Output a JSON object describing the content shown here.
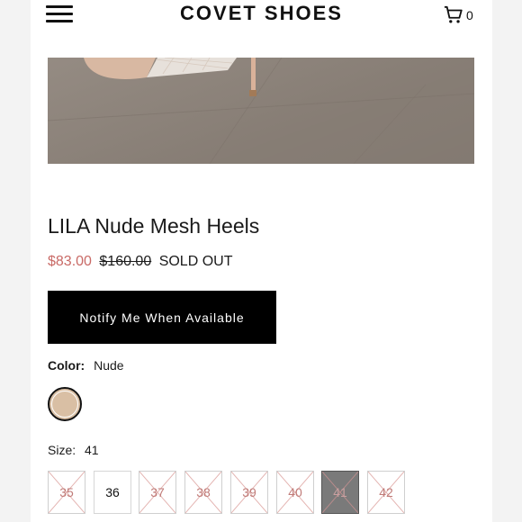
{
  "header": {
    "brand": "COVET SHOES",
    "cart_count": "0",
    "menu_icon": "hamburger-menu-icon",
    "cart_icon": "shopping-cart-icon"
  },
  "product": {
    "title": "LILA Nude Mesh Heels",
    "sale_price": "$83.00",
    "original_price": "$160.00",
    "stock_status": "SOLD OUT",
    "notify_button": "Notify Me When Available",
    "color_label": "Color:",
    "color_value": "Nude",
    "size_label": "Size:",
    "size_value": "41"
  },
  "sizes": [
    {
      "label": "35",
      "available": false,
      "selected": false
    },
    {
      "label": "36",
      "available": true,
      "selected": false
    },
    {
      "label": "37",
      "available": false,
      "selected": false
    },
    {
      "label": "38",
      "available": false,
      "selected": false
    },
    {
      "label": "39",
      "available": false,
      "selected": false
    },
    {
      "label": "40",
      "available": false,
      "selected": false
    },
    {
      "label": "41",
      "available": false,
      "selected": true
    },
    {
      "label": "42",
      "available": false,
      "selected": false
    }
  ],
  "colors": {
    "sale_price": "#c96a66",
    "button_bg": "#000000",
    "swatch_nude": "#d9bfa4",
    "unavailable_size_text": "#c07b78"
  }
}
